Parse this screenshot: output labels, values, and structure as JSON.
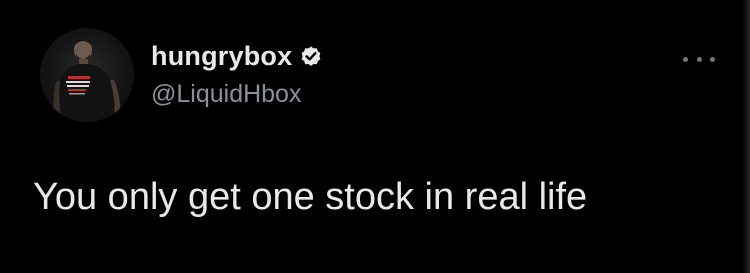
{
  "tweet": {
    "display_name": "hungrybox",
    "handle": "@LiquidHbox",
    "text": "You only get one stock in real life",
    "verified": true,
    "icons": {
      "avatar": "profile-photo",
      "verified": "verified-badge-icon",
      "more": "more-options-icon"
    },
    "colors": {
      "background": "#000000",
      "primary_text": "#e7e9ea",
      "secondary_text": "#8b9197",
      "icon_muted": "#71767b"
    }
  }
}
